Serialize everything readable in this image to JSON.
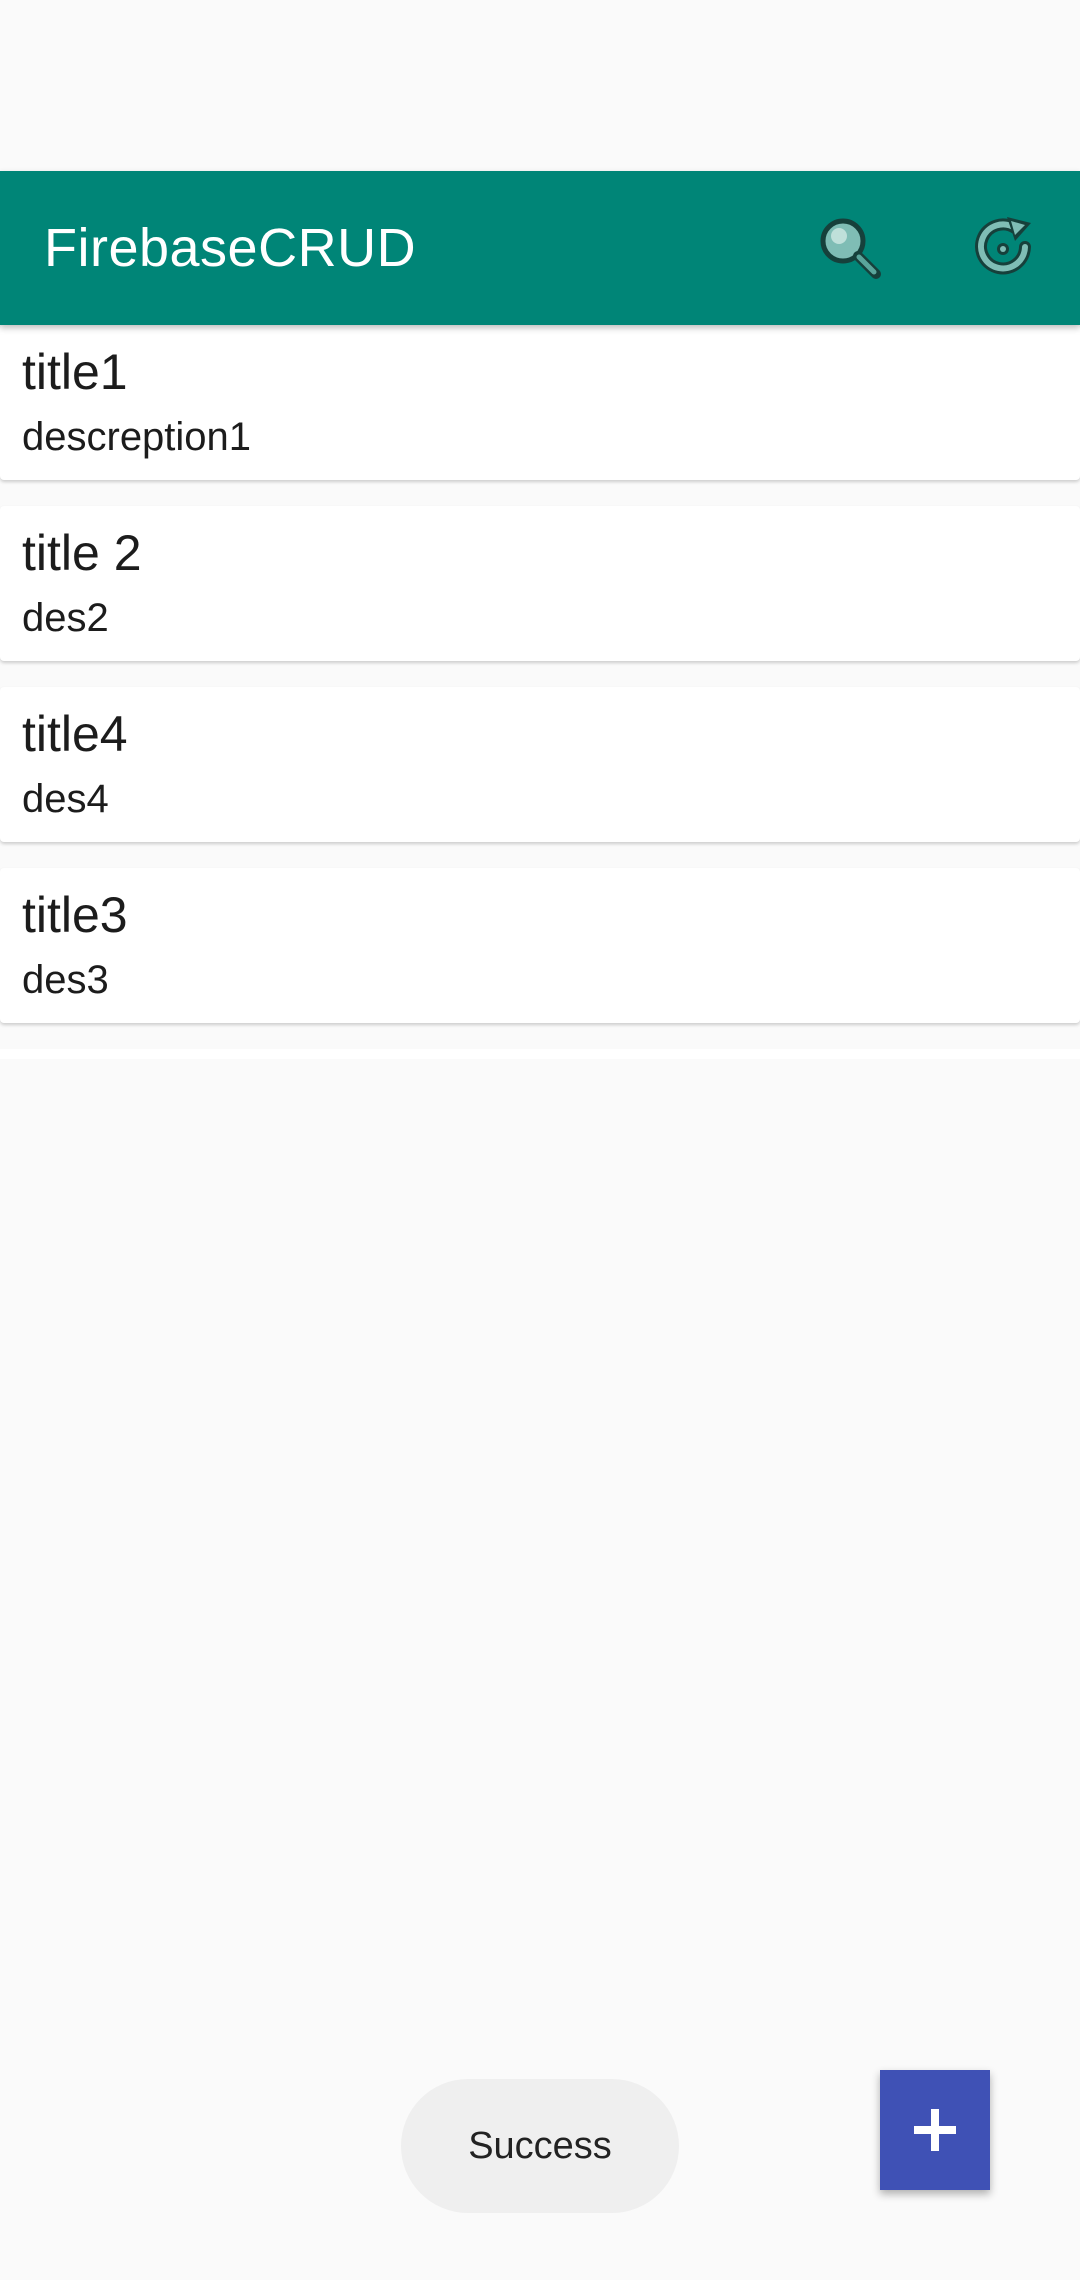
{
  "app_bar": {
    "title": "FirebaseCRUD",
    "background_color": "#008577",
    "actions": [
      {
        "name": "search",
        "icon": "search-icon"
      },
      {
        "name": "refresh",
        "icon": "refresh-icon"
      }
    ]
  },
  "list": {
    "items": [
      {
        "title": "title1",
        "description": "descreption1"
      },
      {
        "title": "title 2",
        "description": "des2"
      },
      {
        "title": "title4",
        "description": "des4"
      },
      {
        "title": "title3",
        "description": "des3"
      }
    ]
  },
  "toast": {
    "message": "Success"
  },
  "fab": {
    "icon": "plus-icon",
    "color": "#3f51b5"
  }
}
